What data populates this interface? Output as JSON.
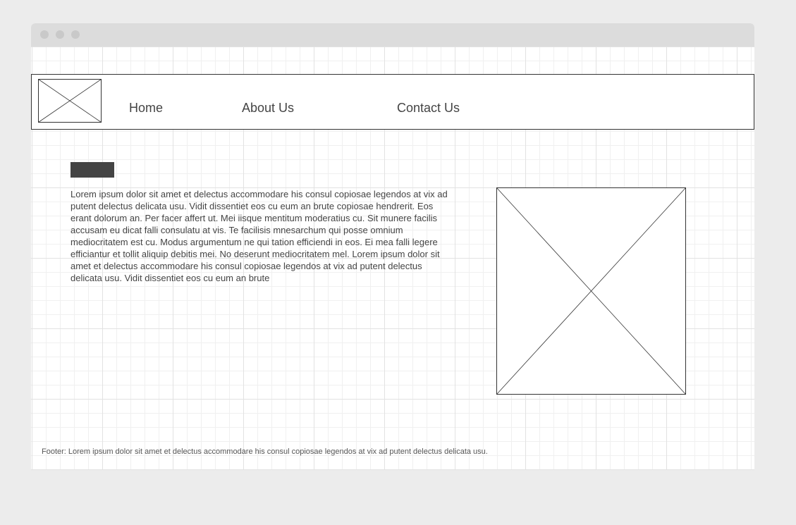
{
  "window": {
    "controls": [
      "close-dot",
      "minimize-dot",
      "maximize-dot"
    ]
  },
  "navbar": {
    "links": [
      {
        "label": "Home"
      },
      {
        "label": "About Us"
      },
      {
        "label": "Contact Us"
      }
    ]
  },
  "main": {
    "body_text": "Lorem ipsum dolor sit amet et delectus accommodare his consul copiosae legendos at vix ad putent delectus delicata usu. Vidit dissentiet eos cu eum an brute copiosae hendrerit. Eos erant dolorum an. Per facer affert ut. Mei iisque mentitum moderatius cu. Sit munere facilis accusam eu dicat falli consulatu at vis. Te facilisis mnesarchum qui posse omnium mediocritatem est cu. Modus argumentum ne qui tation efficiendi in eos. Ei mea falli legere efficiantur et tollit aliquip debitis mei. No deserunt mediocritatem mel. Lorem ipsum dolor sit amet et delectus accommodare his consul copiosae legendos at vix ad putent delectus delicata usu. Vidit dissentiet eos cu eum an brute"
  },
  "footer": {
    "text": "Footer: Lorem ipsum dolor sit amet et delectus accommodare his consul copiosae legendos at vix ad putent delectus delicata usu."
  },
  "colors": {
    "page_background": "#ececec",
    "titlebar": "#dcdcdc",
    "window_dot": "#c9c9c9",
    "heading_bar": "#444444",
    "text": "#444444",
    "border": "#333333"
  }
}
